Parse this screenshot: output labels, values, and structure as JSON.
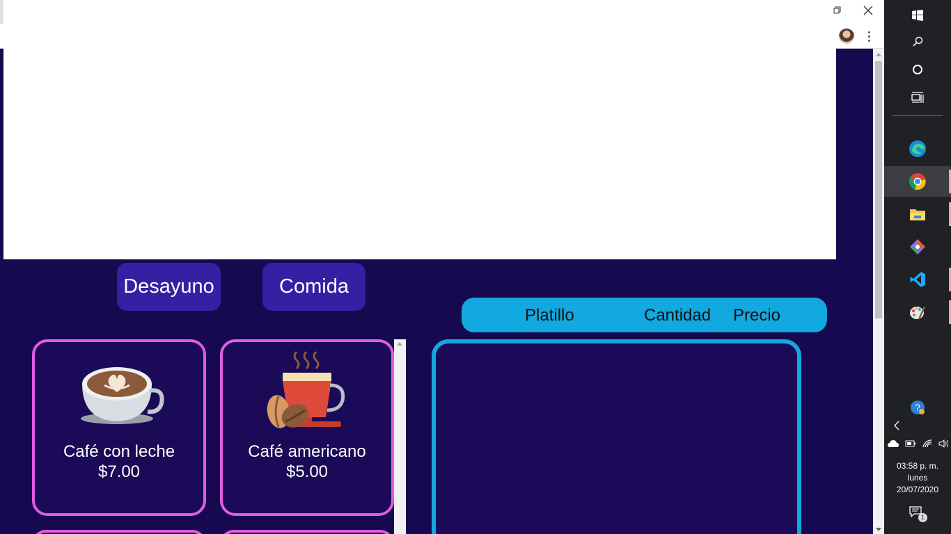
{
  "menu": {
    "categories": [
      "Desayuno",
      "Comida"
    ],
    "items": [
      {
        "name": "Café con leche",
        "price": "$7.00",
        "image": "latte-cup-icon"
      },
      {
        "name": "Café americano",
        "price": "$5.00",
        "image": "americano-cup-icon"
      }
    ]
  },
  "order_table": {
    "headers": [
      "Platillo",
      "Cantidad",
      "Precio"
    ]
  },
  "taskbar": {
    "pinned_apps": [
      "edge-icon",
      "chrome-icon",
      "file-explorer-icon",
      "git-icon",
      "vscode-icon",
      "paint-icon"
    ],
    "clock": {
      "time": "03:58 p. m.",
      "day": "lunes",
      "date": "20/07/2020"
    },
    "notification_count": "1"
  },
  "colors": {
    "page_bg": "#16094f",
    "category_button": "#3520a4",
    "card_border": "#e15ce3",
    "order_accent": "#12a8e0"
  }
}
